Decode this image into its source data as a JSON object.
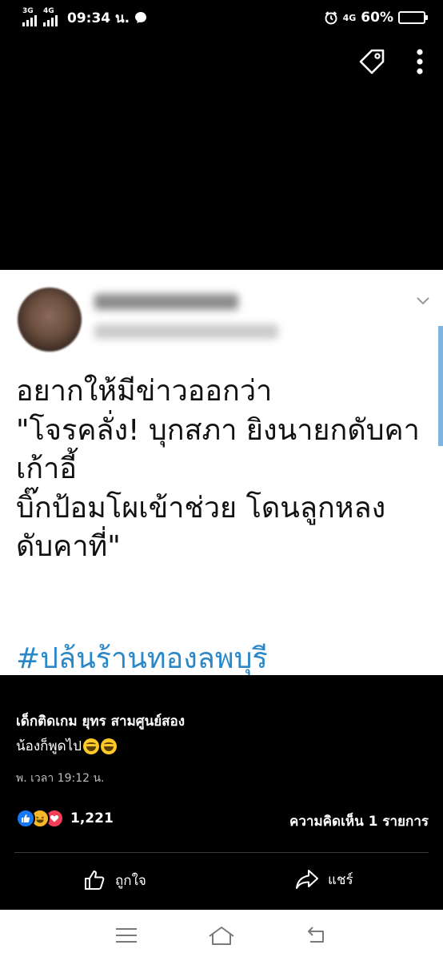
{
  "status_bar": {
    "signal_1_label": "3G",
    "signal_2_label": "4G",
    "time": "09:34 น.",
    "network_label": "4G",
    "battery": "60%",
    "battery_level": 0.6
  },
  "top_actions": {
    "icons": [
      "tag-icon",
      "more-vertical-icon"
    ]
  },
  "tweet": {
    "text": "อยากให้มีข่าวออกว่า\n\"โจรคลั่ง! บุกสภา ยิงนายกดับคา\nเก้าอี้\nบิ๊กป้อมโผเข้าช่วย โดนลูกหลง\nดับคาที่\"",
    "hashtag": "#ปล้นร้านทองลพบุรี"
  },
  "post": {
    "author": "เด็กติดเกม ยุทร สามศูนย์สอง",
    "caption": "น้องก็พูดไป",
    "timestamp": "พ. เวลา 19:12 น.",
    "reaction_count": "1,221",
    "comments": "ความคิดเห็น 1 รายการ",
    "like_label": "ถูกใจ",
    "share_label": "แชร์"
  },
  "colors": {
    "hashtag": "#2b88c8",
    "like_blue": "#1877f2",
    "love_red": "#f33e58",
    "haha_yellow": "#f7b928"
  }
}
